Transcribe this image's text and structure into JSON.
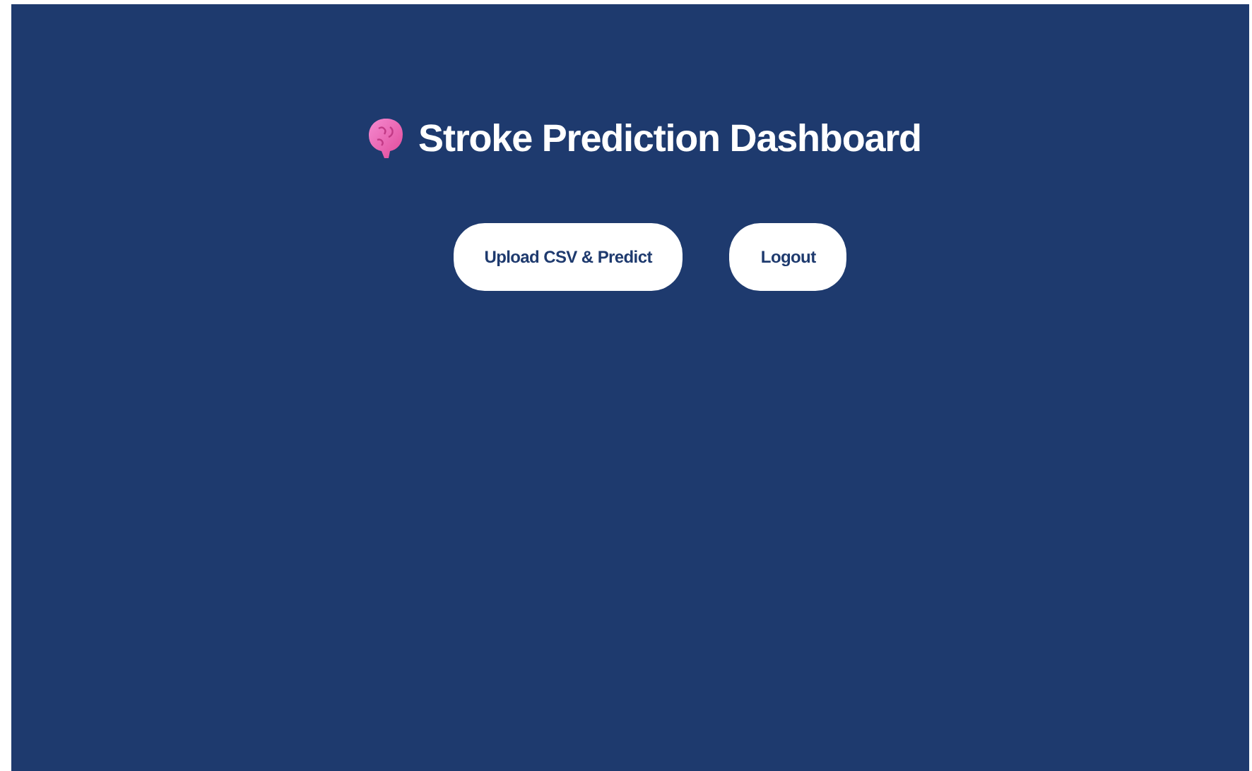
{
  "title": "Stroke Prediction Dashboard",
  "buttons": [
    {
      "label": "Upload CSV & Predict"
    },
    {
      "label": "Logout"
    }
  ]
}
